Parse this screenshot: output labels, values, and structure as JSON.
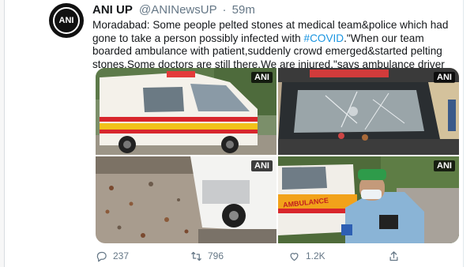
{
  "tweet": {
    "avatar_text": "ANI",
    "name": "ANI UP",
    "handle": "@ANINewsUP",
    "separator": "·",
    "time": "59m",
    "text_before": "Moradabad: Some people pelted stones at medical team&police which had gone to take a person possibly infected with ",
    "hashtag": "#COVID",
    "text_after": ".\"When our team boarded ambulance with patient,suddenly crowd emerged&started pelting stones.Some doctors are still there.We are injured,\"says ambulance driver"
  },
  "media": {
    "watermark": "ANI",
    "ambulance_text": "AMBULANCE"
  },
  "actions": {
    "reply_count": "237",
    "retweet_count": "796",
    "like_count": "1.2K"
  },
  "colors": {
    "link": "#1b95e0",
    "muted": "#657786",
    "text": "#14171a"
  }
}
